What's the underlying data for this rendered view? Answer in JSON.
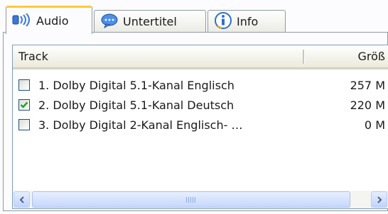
{
  "tabs": [
    {
      "label": "Audio",
      "icon": "speaker-icon",
      "active": true
    },
    {
      "label": "Untertitel",
      "icon": "speech-bubble-icon",
      "active": false
    },
    {
      "label": "Info",
      "icon": "info-icon",
      "active": false
    }
  ],
  "list": {
    "columns": {
      "track": "Track",
      "size": "Größ"
    },
    "rows": [
      {
        "name": "1. Dolby Digital 5.1-Kanal Englisch",
        "size": "257 M",
        "checked": false
      },
      {
        "name": "2. Dolby Digital 5.1-Kanal Deutsch",
        "size": "220 M",
        "checked": true
      },
      {
        "name": "3. Dolby Digital 2-Kanal Englisch- …",
        "size": "0 M",
        "checked": false
      }
    ]
  },
  "colors": {
    "active_tab_accent": "#ffc83c",
    "check": "#21a121",
    "border": "#7f9db9"
  }
}
